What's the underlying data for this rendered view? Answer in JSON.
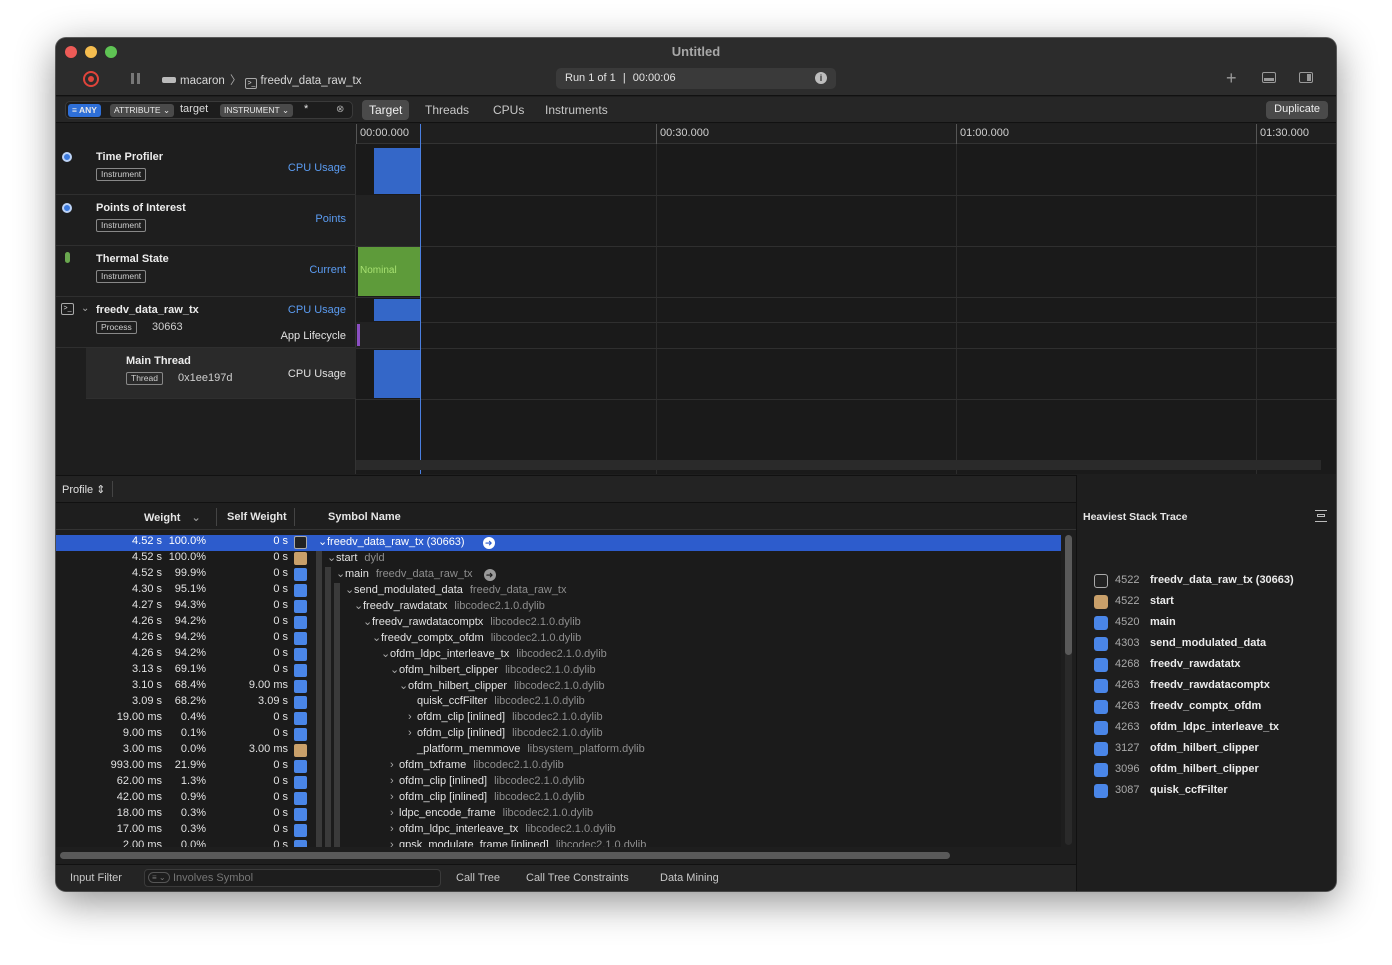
{
  "window": {
    "title": "Untitled"
  },
  "titlebar": {
    "device": "macaron",
    "process": "freedv_data_raw_tx",
    "run_label": "Run 1 of 1",
    "elapsed": "00:00:06",
    "info_icon": "i"
  },
  "toolbar": {
    "filter": {
      "any": "ANY",
      "attribute": "ATTRIBUTE",
      "field": "target",
      "instrument": "INSTRUMENT",
      "value": "*"
    },
    "tabs": [
      "Target",
      "Threads",
      "CPUs",
      "Instruments"
    ],
    "selected_tab": "Target",
    "duplicate_label": "Duplicate"
  },
  "ruler": {
    "ticks": [
      "00:00.000",
      "00:30.000",
      "01:00.000",
      "01:30.000"
    ]
  },
  "tracks": [
    {
      "name": "Time Profiler",
      "badge": "Instrument",
      "metric": "CPU Usage"
    },
    {
      "name": "Points of Interest",
      "badge": "Instrument",
      "metric": "Points"
    },
    {
      "name": "Thermal State",
      "badge": "Instrument",
      "metric": "Current",
      "state": "Nominal"
    },
    {
      "name": "freedv_data_raw_tx",
      "badge": "Process",
      "id": "30663",
      "metric": "CPU Usage",
      "metric2": "App Lifecycle"
    },
    {
      "name": "Main Thread",
      "badge": "Thread",
      "id": "0x1ee197d",
      "metric": "CPU Usage"
    }
  ],
  "profile": {
    "mode_label": "Profile",
    "columns": {
      "weight": "Weight",
      "self_weight": "Self Weight",
      "symbol": "Symbol Name"
    },
    "rows": [
      {
        "weight": "4.52 s",
        "pct": "100.0%",
        "self": "0 s",
        "icon": "term",
        "depth": 0,
        "arrow": "▾",
        "symbol": "freedv_data_raw_tx (30663)",
        "lib": ""
      },
      {
        "weight": "4.52 s",
        "pct": "100.0%",
        "self": "0 s",
        "icon": "app",
        "depth": 1,
        "arrow": "▾",
        "symbol": "start",
        "lib": "dyld"
      },
      {
        "weight": "4.52 s",
        "pct": "99.9%",
        "self": "0 s",
        "icon": "user",
        "depth": 2,
        "arrow": "▾",
        "symbol": "main",
        "lib": "freedv_data_raw_tx"
      },
      {
        "weight": "4.30 s",
        "pct": "95.1%",
        "self": "0 s",
        "icon": "user",
        "depth": 3,
        "arrow": "▾",
        "symbol": "send_modulated_data",
        "lib": "freedv_data_raw_tx"
      },
      {
        "weight": "4.27 s",
        "pct": "94.3%",
        "self": "0 s",
        "icon": "user",
        "depth": 4,
        "arrow": "▾",
        "symbol": "freedv_rawdatatx",
        "lib": "libcodec2.1.0.dylib"
      },
      {
        "weight": "4.26 s",
        "pct": "94.2%",
        "self": "0 s",
        "icon": "user",
        "depth": 5,
        "arrow": "▾",
        "symbol": "freedv_rawdatacomptx",
        "lib": "libcodec2.1.0.dylib"
      },
      {
        "weight": "4.26 s",
        "pct": "94.2%",
        "self": "0 s",
        "icon": "user",
        "depth": 6,
        "arrow": "▾",
        "symbol": "freedv_comptx_ofdm",
        "lib": "libcodec2.1.0.dylib"
      },
      {
        "weight": "4.26 s",
        "pct": "94.2%",
        "self": "0 s",
        "icon": "user",
        "depth": 7,
        "arrow": "▾",
        "symbol": "ofdm_ldpc_interleave_tx",
        "lib": "libcodec2.1.0.dylib"
      },
      {
        "weight": "3.13 s",
        "pct": "69.1%",
        "self": "0 s",
        "icon": "user",
        "depth": 8,
        "arrow": "▾",
        "symbol": "ofdm_hilbert_clipper",
        "lib": "libcodec2.1.0.dylib"
      },
      {
        "weight": "3.10 s",
        "pct": "68.4%",
        "self": "9.00 ms",
        "icon": "user",
        "depth": 9,
        "arrow": "▾",
        "symbol": "ofdm_hilbert_clipper",
        "lib": "libcodec2.1.0.dylib"
      },
      {
        "weight": "3.09 s",
        "pct": "68.2%",
        "self": "3.09 s",
        "icon": "user",
        "depth": 10,
        "arrow": "",
        "symbol": "quisk_ccfFilter",
        "lib": "libcodec2.1.0.dylib"
      },
      {
        "weight": "19.00 ms",
        "pct": "0.4%",
        "self": "0 s",
        "icon": "user",
        "depth": 10,
        "arrow": "›",
        "symbol": "ofdm_clip [inlined]",
        "lib": "libcodec2.1.0.dylib"
      },
      {
        "weight": "9.00 ms",
        "pct": "0.1%",
        "self": "0 s",
        "icon": "user",
        "depth": 10,
        "arrow": "›",
        "symbol": "ofdm_clip [inlined]",
        "lib": "libcodec2.1.0.dylib"
      },
      {
        "weight": "3.00 ms",
        "pct": "0.0%",
        "self": "3.00 ms",
        "icon": "app",
        "depth": 10,
        "arrow": "",
        "symbol": "_platform_memmove",
        "lib": "libsystem_platform.dylib"
      },
      {
        "weight": "993.00 ms",
        "pct": "21.9%",
        "self": "0 s",
        "icon": "user",
        "depth": 8,
        "arrow": "›",
        "symbol": "ofdm_txframe",
        "lib": "libcodec2.1.0.dylib"
      },
      {
        "weight": "62.00 ms",
        "pct": "1.3%",
        "self": "0 s",
        "icon": "user",
        "depth": 8,
        "arrow": "›",
        "symbol": "ofdm_clip [inlined]",
        "lib": "libcodec2.1.0.dylib"
      },
      {
        "weight": "42.00 ms",
        "pct": "0.9%",
        "self": "0 s",
        "icon": "user",
        "depth": 8,
        "arrow": "›",
        "symbol": "ofdm_clip [inlined]",
        "lib": "libcodec2.1.0.dylib"
      },
      {
        "weight": "18.00 ms",
        "pct": "0.3%",
        "self": "0 s",
        "icon": "user",
        "depth": 8,
        "arrow": "›",
        "symbol": "ldpc_encode_frame",
        "lib": "libcodec2.1.0.dylib"
      },
      {
        "weight": "17.00 ms",
        "pct": "0.3%",
        "self": "0 s",
        "icon": "user",
        "depth": 8,
        "arrow": "›",
        "symbol": "ofdm_ldpc_interleave_tx",
        "lib": "libcodec2.1.0.dylib"
      },
      {
        "weight": "2.00 ms",
        "pct": "0.0%",
        "self": "0 s",
        "icon": "user",
        "depth": 8,
        "arrow": "›",
        "symbol": "qpsk_modulate_frame [inlined]",
        "lib": "libcodec2.1.0.dylib"
      }
    ]
  },
  "heaviest": {
    "title": "Heaviest Stack Trace",
    "items": [
      {
        "n": "4522",
        "s": "freedv_data_raw_tx (30663)",
        "icon": "term"
      },
      {
        "n": "4522",
        "s": "start",
        "icon": "app"
      },
      {
        "n": "4520",
        "s": "main",
        "icon": "user"
      },
      {
        "n": "4303",
        "s": "send_modulated_data",
        "icon": "user"
      },
      {
        "n": "4268",
        "s": "freedv_rawdatatx",
        "icon": "user"
      },
      {
        "n": "4263",
        "s": "freedv_rawdatacomptx",
        "icon": "user"
      },
      {
        "n": "4263",
        "s": "freedv_comptx_ofdm",
        "icon": "user"
      },
      {
        "n": "4263",
        "s": "ofdm_ldpc_interleave_tx",
        "icon": "user"
      },
      {
        "n": "3127",
        "s": "ofdm_hilbert_clipper",
        "icon": "user"
      },
      {
        "n": "3096",
        "s": "ofdm_hilbert_clipper",
        "icon": "user"
      },
      {
        "n": "3087",
        "s": "quisk_ccfFilter",
        "icon": "user"
      }
    ]
  },
  "bottom": {
    "input_filter_label": "Input Filter",
    "search_placeholder": "Involves Symbol",
    "buttons": [
      "Call Tree",
      "Call Tree Constraints",
      "Data Mining"
    ]
  },
  "colors": {
    "selection": "#2d5ccc",
    "cpu_block": "#3467c8",
    "thermal": "#5e9b3a",
    "accent": "#5b9cf2"
  }
}
